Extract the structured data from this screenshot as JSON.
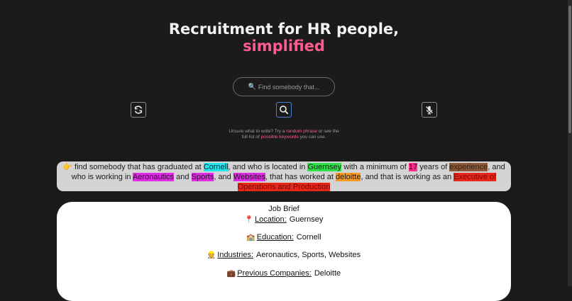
{
  "header": {
    "line1": "Recruitment for HR people,",
    "line2": "simplified"
  },
  "search": {
    "placeholder": "Find somebody that..."
  },
  "hint": {
    "text1": "Unsure what to write? Try a ",
    "random_link": "random phrase",
    "text2": " or see the",
    "text3": "full list of ",
    "keywords_link": "possible keywords",
    "text4": " you can use."
  },
  "query": {
    "emoji": "👉",
    "t1": " find somebody that has graduated at ",
    "education": "Cornell",
    "t2": ", and who is located in ",
    "location": "Guernsey",
    "t3": " with a minimum of ",
    "years": "17",
    "t4": " years of ",
    "experience": "experience",
    "t5": ", and who is working in ",
    "industry1": "Aeronautics",
    "t6": " and ",
    "industry2": "Sports",
    "t7": ", and ",
    "industry3": "Websites",
    "t8": ", that has worked at ",
    "company": "deloitte",
    "t9": ", and that is working as an ",
    "role": "Executive of Operations and Production"
  },
  "brief": {
    "title": "Job Brief",
    "rows": [
      {
        "emoji": "📍",
        "label": "Location:",
        "value": "Guernsey"
      },
      {
        "emoji": "🏫",
        "label": "Education:",
        "value": "Cornell"
      },
      {
        "emoji": "👷",
        "label": "Industries:",
        "value": "Aeronautics, Sports, Websites"
      },
      {
        "emoji": "💼",
        "label": "Previous Companies:",
        "value": "Deloitte"
      }
    ]
  },
  "colors": {
    "accent": "#ff5d8f",
    "background": "#1b1b1b"
  },
  "icons": [
    "refresh-icon",
    "search-icon",
    "microphone-off-icon",
    "magnifier-icon"
  ]
}
